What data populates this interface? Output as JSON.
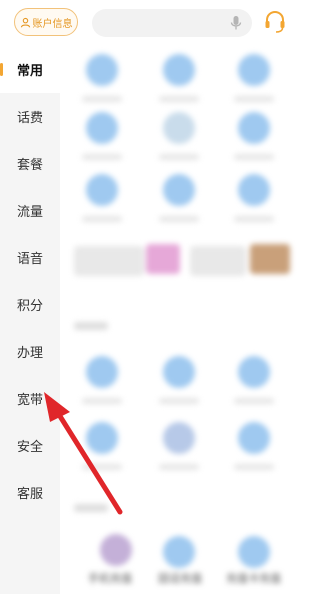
{
  "header": {
    "account_label": "账户信息",
    "search_placeholder": "",
    "mic_icon": "mic-icon",
    "support_icon": "headset-icon",
    "accent_color": "#f3a632"
  },
  "sidebar": {
    "items": [
      {
        "label": "常用",
        "active": true
      },
      {
        "label": "话费",
        "active": false
      },
      {
        "label": "套餐",
        "active": false
      },
      {
        "label": "流量",
        "active": false
      },
      {
        "label": "语音",
        "active": false
      },
      {
        "label": "积分",
        "active": false
      },
      {
        "label": "办理",
        "active": false
      },
      {
        "label": "宽带",
        "active": false
      },
      {
        "label": "安全",
        "active": false
      },
      {
        "label": "客服",
        "active": false
      }
    ]
  },
  "content": {
    "bottom_labels": [
      "手机充值",
      "固话充值",
      "充值卡充值"
    ]
  },
  "annotation": {
    "arrow_color": "#e0262a",
    "points_to": "宽带"
  }
}
